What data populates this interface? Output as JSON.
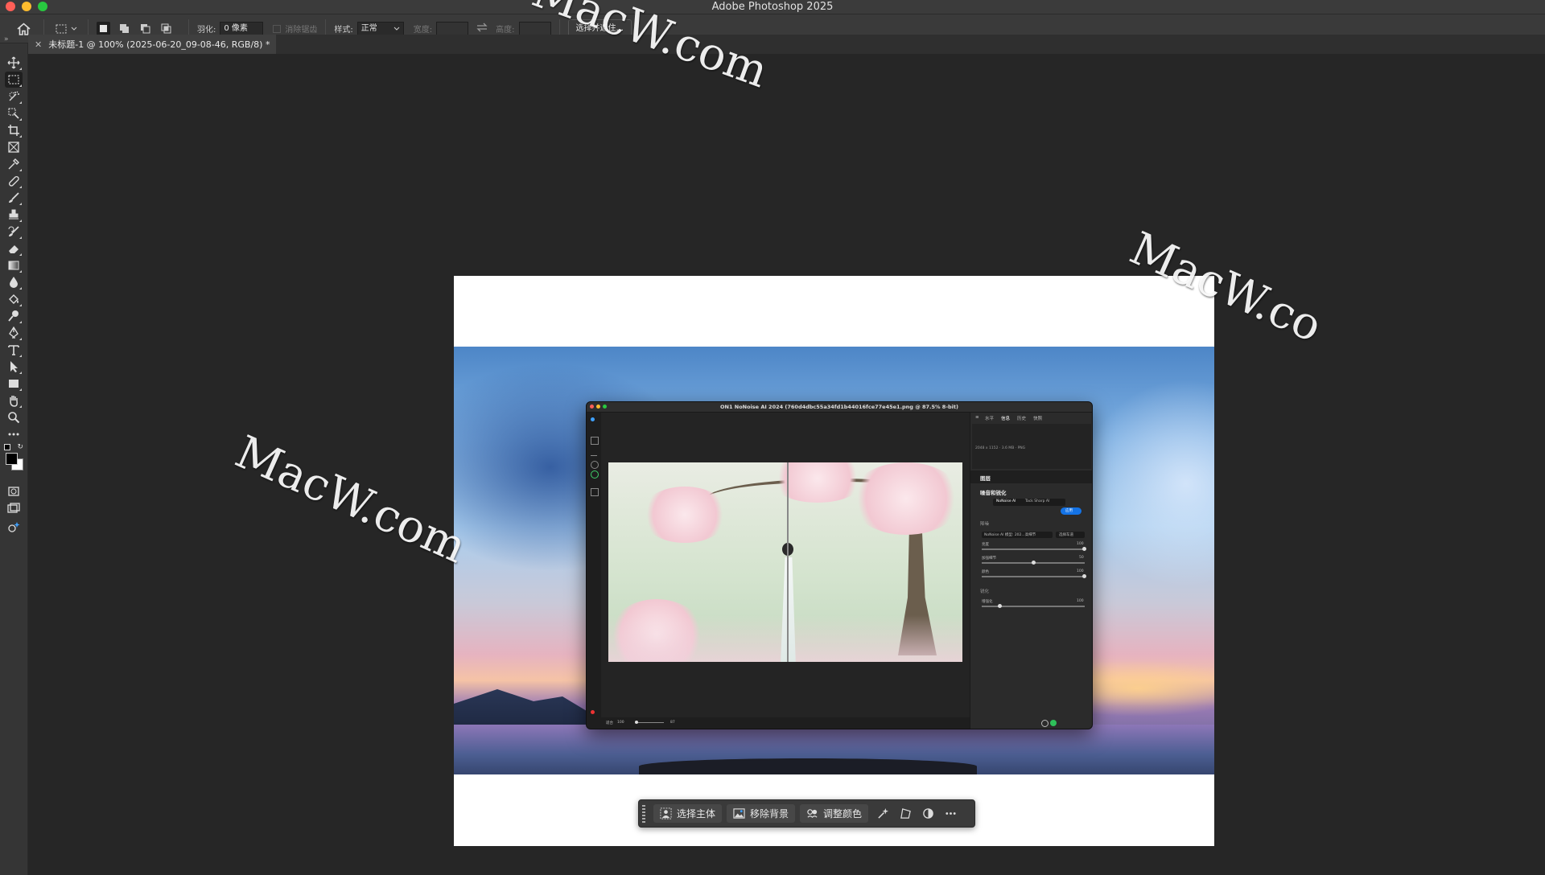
{
  "app": {
    "title": "Adobe Photoshop 2025"
  },
  "options_bar": {
    "feather_label": "羽化:",
    "feather_value": "0 像素",
    "antialias_label": "消除锯齿",
    "style_label": "样式:",
    "style_value": "正常",
    "width_label": "宽度:",
    "height_label": "高度:",
    "select_mask_button": "选择并遮住..."
  },
  "document_tab": {
    "title": "未标题-1 @ 100% (2025-06-20_09-08-46, RGB/8) *"
  },
  "on1_window": {
    "title": "ON1 NoNoise AI 2024 (760d4dbc55a34fd1b44016fce77e45e1.png @ 87.5% 8-bit)",
    "panel_tabs": [
      "水平",
      "信息",
      "历史",
      "快照"
    ],
    "info_text": "2048 x 1152 · 3.6 MB · PNG",
    "layers_header": "图层",
    "section_title": "噪音和锐化",
    "mode_tabs": [
      "NoNoise AI",
      "Tack Sharp AI"
    ],
    "apply_button": "应用",
    "noise_group": "降噪",
    "model_label": "NoNoise AI 模型: 202...高细节",
    "model_button": "选择车道",
    "sliders": [
      {
        "label": "亮度",
        "value": "100"
      },
      {
        "label": "加强细节",
        "value": "50"
      },
      {
        "label": "颜色",
        "value": "100"
      }
    ],
    "sharpen_group": "锐化",
    "sharpen_slider": {
      "label": "增强化",
      "value": "100"
    },
    "bottom_fit": "适合",
    "bottom_zoom": "100",
    "bottom_value": "87"
  },
  "taskbar": {
    "select_subject": "选择主体",
    "remove_background": "移除背景",
    "adjust_color": "调整颜色"
  },
  "watermarks": [
    "MacW.com",
    "MacW.com",
    "MacW.co"
  ],
  "colors": {
    "app_bg": "#262626",
    "panel": "#353535",
    "accent_blue": "#1473e6",
    "traffic_red": "#ff5f57",
    "traffic_yellow": "#febc2e",
    "traffic_green": "#28c840"
  }
}
